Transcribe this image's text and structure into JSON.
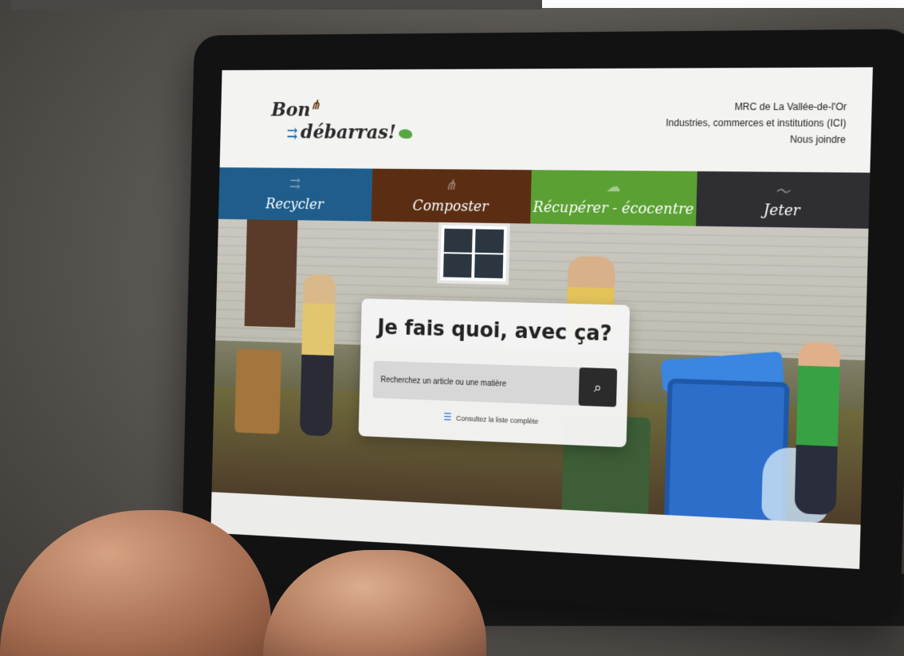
{
  "site": {
    "logo_line1": "Bon",
    "logo_line2": "débarras",
    "logo_exclaim": "!",
    "header_links": [
      "MRC de La Vallée-de-l'Or",
      "Industries, commerces et institutions (ICI)",
      "Nous joindre"
    ]
  },
  "nav": {
    "items": [
      {
        "label": "Recycler",
        "color": "#1f5e8c",
        "icon": "recycle-arrows-icon"
      },
      {
        "label": "Composter",
        "color": "#5b2e14",
        "icon": "fork-icon"
      },
      {
        "label": "Récupérer - écocentre",
        "color": "#5aa033",
        "icon": "cloud-leaf-icon"
      },
      {
        "label": "Jeter",
        "color": "#2f2f33",
        "icon": "swoosh-icon"
      }
    ]
  },
  "search": {
    "title": "Je fais quoi, avec ça?",
    "placeholder": "Recherchez un article ou une matière",
    "list_link": "Consultez la liste complète"
  }
}
